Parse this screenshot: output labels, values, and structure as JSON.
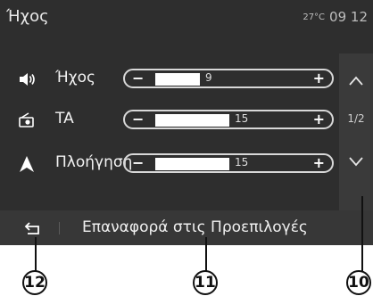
{
  "header": {
    "title": "Ήχος",
    "temperature": "27°C",
    "time": "09 12"
  },
  "settings": [
    {
      "icon": "speaker-icon",
      "label": "Ήχος",
      "value": "9",
      "level": 0.33
    },
    {
      "icon": "traffic-announcement-icon",
      "label": "TA",
      "value": "15",
      "level": 0.55
    },
    {
      "icon": "navigation-arrow-icon",
      "label": "Πλοήγηση",
      "value": "15",
      "level": 0.55
    }
  ],
  "pager": {
    "page": "1/2"
  },
  "footer": {
    "reset_label": "Επαναφορά στις Προεπιλογές"
  },
  "callouts": {
    "back": "12",
    "reset": "11",
    "scroll": "10"
  },
  "colors": {
    "screen": "#2e2e2e",
    "panel": "#3a3a3a",
    "text": "#ffffff"
  }
}
